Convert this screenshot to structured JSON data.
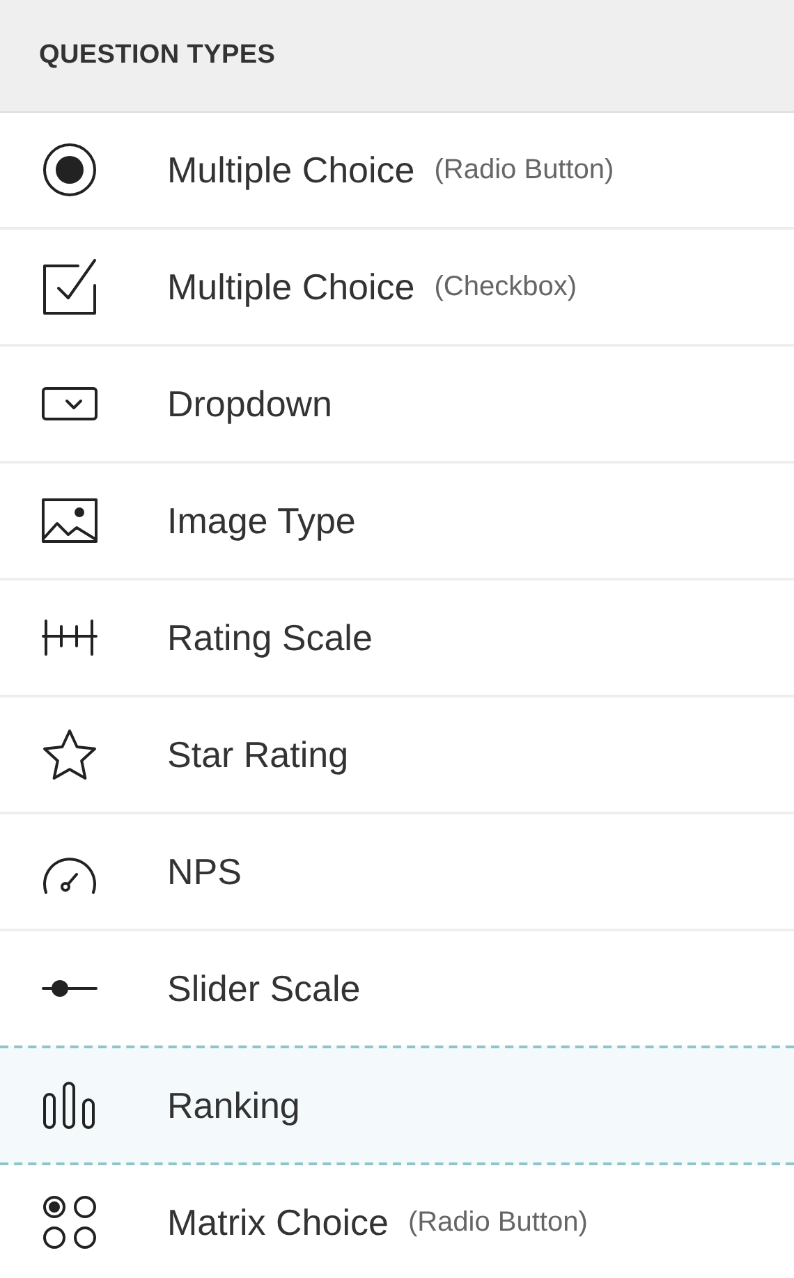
{
  "header": {
    "title": "QUESTION TYPES"
  },
  "items": [
    {
      "kind": "radio",
      "label": "Multiple Choice",
      "sub": "(Radio Button)",
      "selected": false
    },
    {
      "kind": "checkbox",
      "label": "Multiple Choice",
      "sub": "(Checkbox)",
      "selected": false
    },
    {
      "kind": "dropdown",
      "label": "Dropdown",
      "selected": false
    },
    {
      "kind": "image",
      "label": "Image Type",
      "selected": false
    },
    {
      "kind": "scale",
      "label": "Rating Scale",
      "selected": false
    },
    {
      "kind": "star",
      "label": "Star Rating",
      "selected": false
    },
    {
      "kind": "gauge",
      "label": "NPS",
      "selected": false
    },
    {
      "kind": "slider",
      "label": "Slider Scale",
      "selected": false
    },
    {
      "kind": "ranking",
      "label": "Ranking",
      "selected": true
    },
    {
      "kind": "matrix",
      "label": "Matrix Choice",
      "sub": "(Radio Button)",
      "selected": false
    }
  ]
}
